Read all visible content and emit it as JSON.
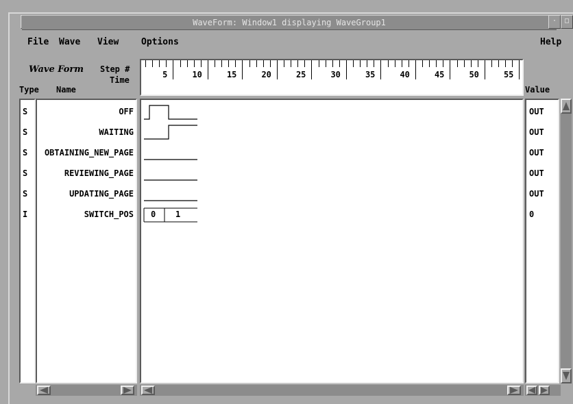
{
  "window": {
    "title": "WaveForm: Window1 displaying WaveGroup1"
  },
  "menubar": {
    "file": "File",
    "wave": "Wave",
    "view": "View",
    "options": "Options",
    "help": "Help"
  },
  "header": {
    "app_label": "Wave Form",
    "step_label": "Step #",
    "time_label": "Time",
    "type_label": "Type",
    "name_label": "Name",
    "value_label": "Value"
  },
  "ruler": {
    "labels": [
      "5",
      "10",
      "15",
      "20",
      "25",
      "30",
      "35",
      "40",
      "45",
      "50",
      "55"
    ]
  },
  "signals": [
    {
      "type": "S",
      "name": "OFF",
      "value": "OUT"
    },
    {
      "type": "S",
      "name": "WAITING",
      "value": "OUT"
    },
    {
      "type": "S",
      "name": "OBTAINING_NEW_PAGE",
      "value": "OUT"
    },
    {
      "type": "S",
      "name": "REVIEWING_PAGE",
      "value": "OUT"
    },
    {
      "type": "S",
      "name": "UPDATING_PAGE",
      "value": "OUT"
    },
    {
      "type": "I",
      "name": "SWITCH_POS",
      "value": "0"
    }
  ],
  "switch_pos_bus": [
    "0",
    "1"
  ]
}
